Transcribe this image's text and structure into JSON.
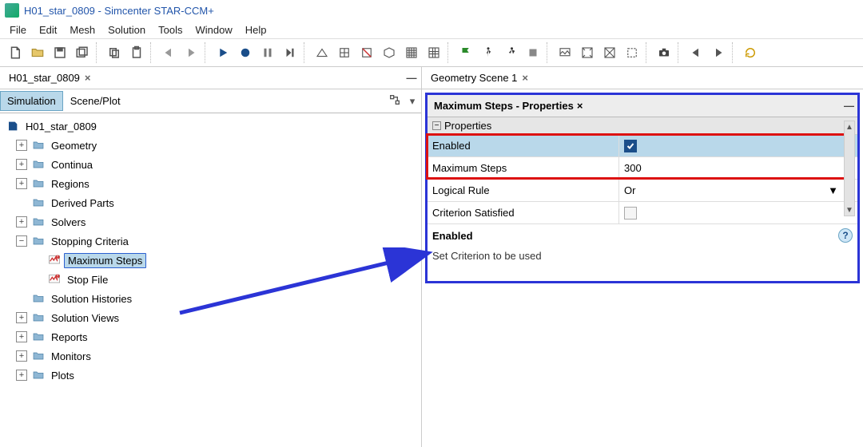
{
  "app_title": "H01_star_0809 - Simcenter STAR-CCM+",
  "menu": [
    "File",
    "Edit",
    "Mesh",
    "Solution",
    "Tools",
    "Window",
    "Help"
  ],
  "left_panel": {
    "tab": "H01_star_0809",
    "sub_tabs": [
      "Simulation",
      "Scene/Plot"
    ],
    "tree": {
      "root": "H01_star_0809",
      "items": [
        {
          "label": "Geometry",
          "children": 0
        },
        {
          "label": "Continua",
          "children": 0
        },
        {
          "label": "Regions",
          "children": 0
        },
        {
          "label": "Derived Parts",
          "children": 0
        },
        {
          "label": "Solvers",
          "children": 0
        },
        {
          "label": "Stopping Criteria",
          "expanded": true,
          "children": [
            {
              "label": "Maximum Steps",
              "selected": true,
              "icon": "criteria"
            },
            {
              "label": "Stop File",
              "icon": "criteria"
            }
          ]
        },
        {
          "label": "Solution Histories",
          "children": 0
        },
        {
          "label": "Solution Views",
          "children": 0
        },
        {
          "label": "Reports",
          "children": 0
        },
        {
          "label": "Monitors",
          "children": 0
        },
        {
          "label": "Plots",
          "children": 0
        }
      ]
    }
  },
  "right_panel": {
    "scene_tab": "Geometry Scene 1",
    "props_tab": "Maximum Steps - Properties",
    "group": "Properties",
    "rows": {
      "enabled_label": "Enabled",
      "maxsteps_label": "Maximum Steps",
      "maxsteps_value": "300",
      "logical_label": "Logical Rule",
      "logical_value": "Or",
      "satisfied_label": "Criterion Satisfied"
    },
    "help_title": "Enabled",
    "help_text": "Set Criterion to be used"
  }
}
